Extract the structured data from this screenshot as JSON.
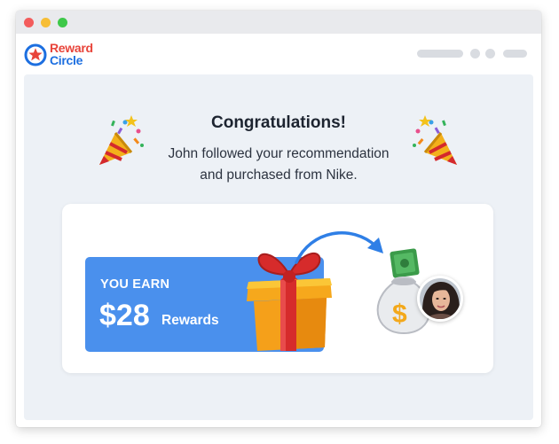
{
  "window": {
    "controls": [
      "close",
      "minimize",
      "maximize"
    ]
  },
  "brand": {
    "name_line1": "Reward",
    "name_line2": "Circle",
    "colors": {
      "red": "#e8443a",
      "blue": "#1d6fe0"
    }
  },
  "notification": {
    "title": "Congratulations!",
    "message_line1": "John followed your recommendation",
    "message_line2": "and purchased from Nike."
  },
  "reward": {
    "label": "YOU EARN",
    "amount": "$28",
    "unit": "Rewards",
    "box_color": "#4a90ed"
  },
  "icons": {
    "left_decoration": "party-popper-icon",
    "right_decoration": "party-popper-icon",
    "gift": "gift-box-icon",
    "arrow": "curved-arrow-icon",
    "money": "money-bag-icon",
    "user": "user-avatar"
  }
}
